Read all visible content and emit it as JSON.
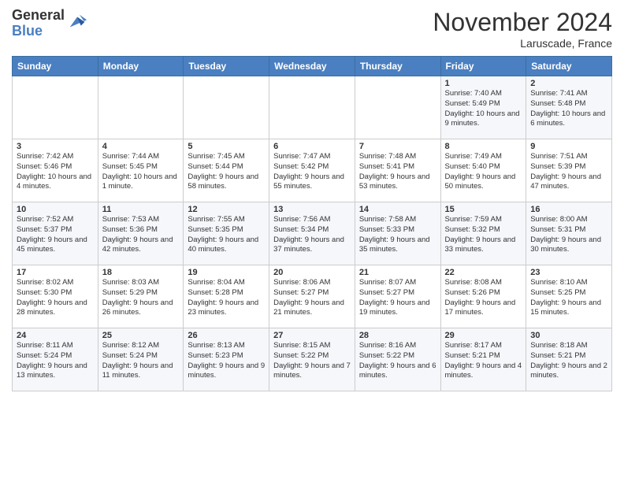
{
  "logo": {
    "general": "General",
    "blue": "Blue"
  },
  "title": "November 2024",
  "location": "Laruscade, France",
  "days_of_week": [
    "Sunday",
    "Monday",
    "Tuesday",
    "Wednesday",
    "Thursday",
    "Friday",
    "Saturday"
  ],
  "weeks": [
    [
      {
        "day": "",
        "info": ""
      },
      {
        "day": "",
        "info": ""
      },
      {
        "day": "",
        "info": ""
      },
      {
        "day": "",
        "info": ""
      },
      {
        "day": "",
        "info": ""
      },
      {
        "day": "1",
        "info": "Sunrise: 7:40 AM\nSunset: 5:49 PM\nDaylight: 10 hours and 9 minutes."
      },
      {
        "day": "2",
        "info": "Sunrise: 7:41 AM\nSunset: 5:48 PM\nDaylight: 10 hours and 6 minutes."
      }
    ],
    [
      {
        "day": "3",
        "info": "Sunrise: 7:42 AM\nSunset: 5:46 PM\nDaylight: 10 hours and 4 minutes."
      },
      {
        "day": "4",
        "info": "Sunrise: 7:44 AM\nSunset: 5:45 PM\nDaylight: 10 hours and 1 minute."
      },
      {
        "day": "5",
        "info": "Sunrise: 7:45 AM\nSunset: 5:44 PM\nDaylight: 9 hours and 58 minutes."
      },
      {
        "day": "6",
        "info": "Sunrise: 7:47 AM\nSunset: 5:42 PM\nDaylight: 9 hours and 55 minutes."
      },
      {
        "day": "7",
        "info": "Sunrise: 7:48 AM\nSunset: 5:41 PM\nDaylight: 9 hours and 53 minutes."
      },
      {
        "day": "8",
        "info": "Sunrise: 7:49 AM\nSunset: 5:40 PM\nDaylight: 9 hours and 50 minutes."
      },
      {
        "day": "9",
        "info": "Sunrise: 7:51 AM\nSunset: 5:39 PM\nDaylight: 9 hours and 47 minutes."
      }
    ],
    [
      {
        "day": "10",
        "info": "Sunrise: 7:52 AM\nSunset: 5:37 PM\nDaylight: 9 hours and 45 minutes."
      },
      {
        "day": "11",
        "info": "Sunrise: 7:53 AM\nSunset: 5:36 PM\nDaylight: 9 hours and 42 minutes."
      },
      {
        "day": "12",
        "info": "Sunrise: 7:55 AM\nSunset: 5:35 PM\nDaylight: 9 hours and 40 minutes."
      },
      {
        "day": "13",
        "info": "Sunrise: 7:56 AM\nSunset: 5:34 PM\nDaylight: 9 hours and 37 minutes."
      },
      {
        "day": "14",
        "info": "Sunrise: 7:58 AM\nSunset: 5:33 PM\nDaylight: 9 hours and 35 minutes."
      },
      {
        "day": "15",
        "info": "Sunrise: 7:59 AM\nSunset: 5:32 PM\nDaylight: 9 hours and 33 minutes."
      },
      {
        "day": "16",
        "info": "Sunrise: 8:00 AM\nSunset: 5:31 PM\nDaylight: 9 hours and 30 minutes."
      }
    ],
    [
      {
        "day": "17",
        "info": "Sunrise: 8:02 AM\nSunset: 5:30 PM\nDaylight: 9 hours and 28 minutes."
      },
      {
        "day": "18",
        "info": "Sunrise: 8:03 AM\nSunset: 5:29 PM\nDaylight: 9 hours and 26 minutes."
      },
      {
        "day": "19",
        "info": "Sunrise: 8:04 AM\nSunset: 5:28 PM\nDaylight: 9 hours and 23 minutes."
      },
      {
        "day": "20",
        "info": "Sunrise: 8:06 AM\nSunset: 5:27 PM\nDaylight: 9 hours and 21 minutes."
      },
      {
        "day": "21",
        "info": "Sunrise: 8:07 AM\nSunset: 5:27 PM\nDaylight: 9 hours and 19 minutes."
      },
      {
        "day": "22",
        "info": "Sunrise: 8:08 AM\nSunset: 5:26 PM\nDaylight: 9 hours and 17 minutes."
      },
      {
        "day": "23",
        "info": "Sunrise: 8:10 AM\nSunset: 5:25 PM\nDaylight: 9 hours and 15 minutes."
      }
    ],
    [
      {
        "day": "24",
        "info": "Sunrise: 8:11 AM\nSunset: 5:24 PM\nDaylight: 9 hours and 13 minutes."
      },
      {
        "day": "25",
        "info": "Sunrise: 8:12 AM\nSunset: 5:24 PM\nDaylight: 9 hours and 11 minutes."
      },
      {
        "day": "26",
        "info": "Sunrise: 8:13 AM\nSunset: 5:23 PM\nDaylight: 9 hours and 9 minutes."
      },
      {
        "day": "27",
        "info": "Sunrise: 8:15 AM\nSunset: 5:22 PM\nDaylight: 9 hours and 7 minutes."
      },
      {
        "day": "28",
        "info": "Sunrise: 8:16 AM\nSunset: 5:22 PM\nDaylight: 9 hours and 6 minutes."
      },
      {
        "day": "29",
        "info": "Sunrise: 8:17 AM\nSunset: 5:21 PM\nDaylight: 9 hours and 4 minutes."
      },
      {
        "day": "30",
        "info": "Sunrise: 8:18 AM\nSunset: 5:21 PM\nDaylight: 9 hours and 2 minutes."
      }
    ]
  ]
}
